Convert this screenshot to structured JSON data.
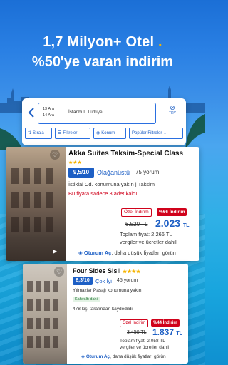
{
  "hero": {
    "line1": "1,7 Milyon+ Otel",
    "line1_dot": ".",
    "line2": "%50'ye varan indirim"
  },
  "search": {
    "back_icon": "chevron-left-icon",
    "checkin": "13 Ara",
    "checkout": "14 Ara",
    "city": "İstanbul, Türkiye",
    "currency": "TRY",
    "filters": [
      {
        "icon": "sort-icon",
        "label": "Sırala"
      },
      {
        "icon": "filter-icon",
        "label": "Filtreler"
      },
      {
        "icon": "location-pin-icon",
        "label": "Konum"
      },
      {
        "icon": "chevron-down-icon",
        "label": "Popüler Filtreler"
      }
    ]
  },
  "hotels": [
    {
      "name": "Akka Suites Taksim-Special Class",
      "stars": "★★★",
      "score": "9,5/10",
      "rating_word": "Olağanüstü",
      "reviews": "75 yorum",
      "location": "İstiklal Cd. konumuna yakın | Taksim",
      "urgency": "Bu fiyata sadece 3 adet kaldı",
      "deal_label": "Özel İndirim",
      "discount": "%66 İndirim",
      "old_price": "6.520 TL",
      "price": "2.023",
      "price_currency": "TL",
      "total": "Toplam fiyat: 2.266 TL",
      "taxes": "vergiler ve ücretler dahil",
      "map_prefix": "Oturum Aç",
      "map_suffix": ", daha düşük fiyatları görün"
    },
    {
      "name": "Four Sides Sisli",
      "stars": "★★★★",
      "score": "8,3/10",
      "rating_word": "Çok İyi",
      "reviews": "45 yorum",
      "location": "Yılmazlar Pasajı konumuna yakın",
      "breakfast": "Kahvaltı dahil",
      "saved": "478 kişi tarafından kaydedildi",
      "deal_label": "Özel İndirim",
      "discount": "%44 İndirim",
      "old_price": "3.450 TL",
      "price": "1.837",
      "price_currency": "TL",
      "total": "Toplam fiyat: 2.058 TL",
      "taxes": "vergiler ve ücretler dahil",
      "map_prefix": "Oturum Aç",
      "map_suffix": ", daha düşük fiyatları görün"
    }
  ],
  "colors": {
    "brand_blue": "#1d5fc5",
    "deal_red": "#d0021b",
    "star_gold": "#f6b400"
  }
}
